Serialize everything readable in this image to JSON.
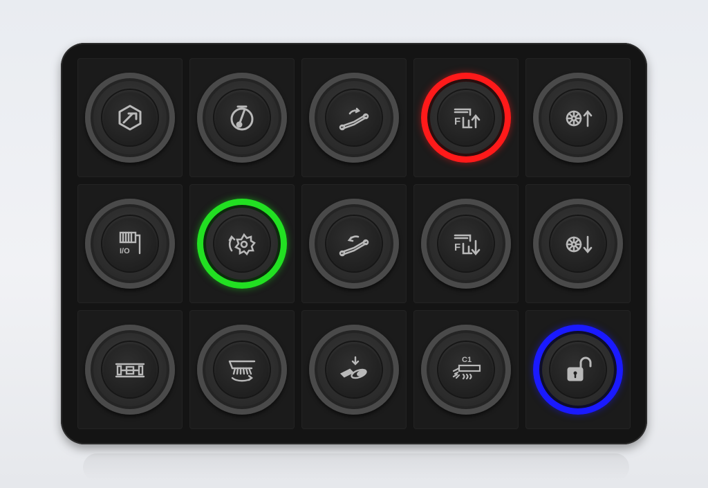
{
  "keypad": {
    "colors": {
      "body": "#141414",
      "red_led": "#ff1a1a",
      "green_led": "#22e022",
      "blue_led": "#1a1aff"
    },
    "buttons": [
      {
        "id": "r1c1",
        "icon": "hex-bolt-icon",
        "state": "off",
        "text": ""
      },
      {
        "id": "r1c2",
        "icon": "piston-icon",
        "state": "off",
        "text": ""
      },
      {
        "id": "r1c3",
        "icon": "hydraulic-arm-up-icon",
        "state": "off",
        "text": ""
      },
      {
        "id": "r1c4",
        "icon": "front-lift-up-icon",
        "state": "red",
        "text": "F"
      },
      {
        "id": "r1c5",
        "icon": "tire-pressure-up-icon",
        "state": "off",
        "text": ""
      },
      {
        "id": "r2c1",
        "icon": "winch-io-icon",
        "state": "off",
        "text": "I/O"
      },
      {
        "id": "r2c2",
        "icon": "saw-blade-rotate-icon",
        "state": "green",
        "text": ""
      },
      {
        "id": "r2c3",
        "icon": "hydraulic-arm-down-icon",
        "state": "off",
        "text": ""
      },
      {
        "id": "r2c4",
        "icon": "front-lift-down-icon",
        "state": "off",
        "text": "F"
      },
      {
        "id": "r2c5",
        "icon": "tire-pressure-down-icon",
        "state": "off",
        "text": ""
      },
      {
        "id": "r3c1",
        "icon": "axle-lock-icon",
        "state": "off",
        "text": ""
      },
      {
        "id": "r3c2",
        "icon": "sweeper-brush-icon",
        "state": "off",
        "text": ""
      },
      {
        "id": "r3c3",
        "icon": "material-spreader-icon",
        "state": "off",
        "text": ""
      },
      {
        "id": "r3c4",
        "icon": "sprayer-c1-icon",
        "state": "off",
        "text": "C1"
      },
      {
        "id": "r3c5",
        "icon": "unlock-icon",
        "state": "blue",
        "text": ""
      }
    ]
  }
}
